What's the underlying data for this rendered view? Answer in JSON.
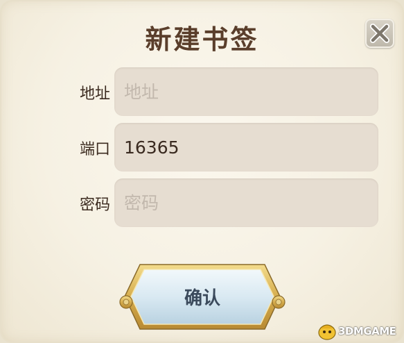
{
  "dialog": {
    "title": "新建书签",
    "close_icon": "close-x-icon"
  },
  "form": {
    "address": {
      "label": "地址",
      "value": "",
      "placeholder": "地址"
    },
    "port": {
      "label": "端口",
      "value": "16365",
      "placeholder": ""
    },
    "password": {
      "label": "密码",
      "value": "",
      "placeholder": "密码"
    }
  },
  "confirm_button": {
    "label": "确认"
  },
  "watermark": {
    "text": "3DMGAME"
  },
  "colors": {
    "title": "#5a3e2b",
    "field_bg": "#e6ddd1",
    "button_face": "#d7e8f1",
    "button_frame": "#d9b65a"
  }
}
